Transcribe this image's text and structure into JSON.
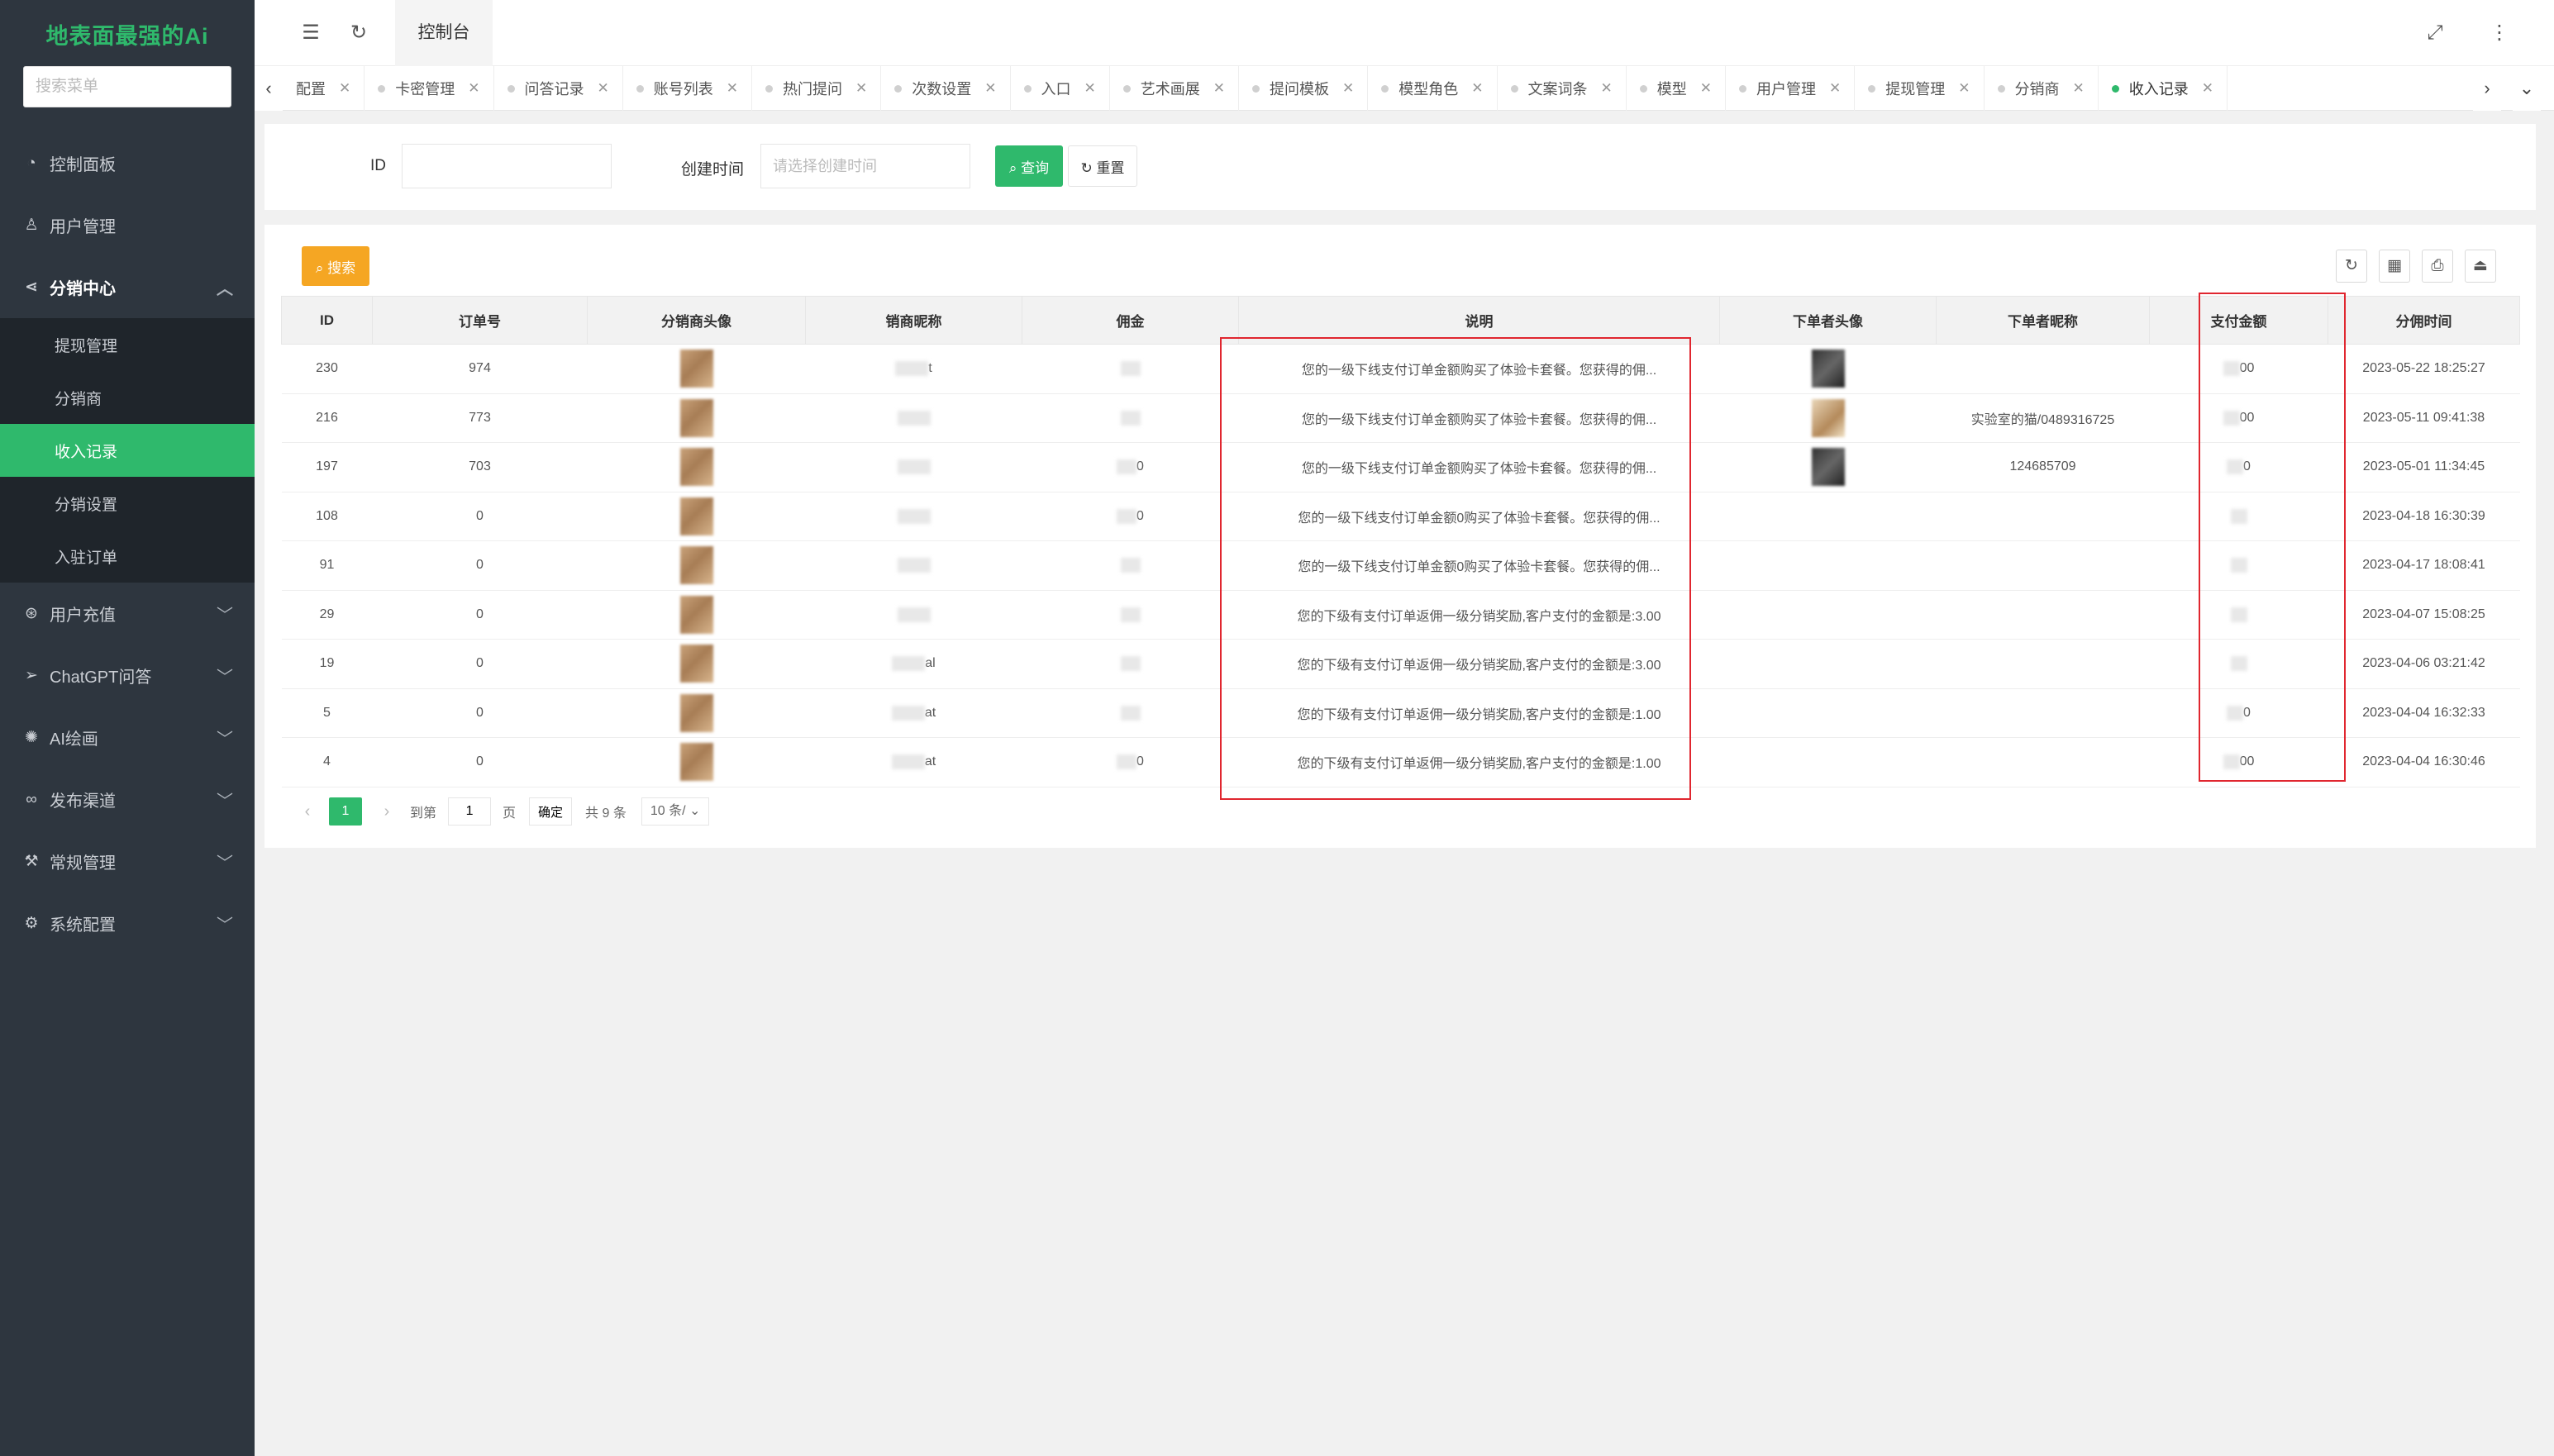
{
  "sidebar": {
    "brand": "地表面最强的Ai",
    "search_placeholder": "搜索菜单",
    "items": [
      {
        "label": "控制面板",
        "icon": "dashboard-icon"
      },
      {
        "label": "用户管理",
        "icon": "user-icon"
      },
      {
        "label": "分销中心",
        "icon": "share-icon",
        "open": true,
        "children": [
          {
            "label": "提现管理"
          },
          {
            "label": "分销商"
          },
          {
            "label": "收入记录",
            "active": true
          },
          {
            "label": "分销设置"
          },
          {
            "label": "入驻订单"
          }
        ]
      },
      {
        "label": "用户充值",
        "icon": "recharge-icon"
      },
      {
        "label": "ChatGPT问答",
        "icon": "send-icon"
      },
      {
        "label": "AI绘画",
        "icon": "palette-icon"
      },
      {
        "label": "发布渠道",
        "icon": "link-icon"
      },
      {
        "label": "常规管理",
        "icon": "tools-icon"
      },
      {
        "label": "系统配置",
        "icon": "gear-icon"
      }
    ]
  },
  "topbar": {
    "console_label": "控制台"
  },
  "tabs": [
    {
      "label": "配置"
    },
    {
      "label": "卡密管理"
    },
    {
      "label": "问答记录"
    },
    {
      "label": "账号列表"
    },
    {
      "label": "热门提问"
    },
    {
      "label": "次数设置"
    },
    {
      "label": "入口"
    },
    {
      "label": "艺术画展"
    },
    {
      "label": "提问模板"
    },
    {
      "label": "模型角色"
    },
    {
      "label": "文案词条"
    },
    {
      "label": "模型"
    },
    {
      "label": "用户管理"
    },
    {
      "label": "提现管理"
    },
    {
      "label": "分销商"
    },
    {
      "label": "收入记录",
      "active": true
    }
  ],
  "search": {
    "id_label": "ID",
    "id_value": "",
    "time_label": "创建时间",
    "time_placeholder": "请选择创建时间",
    "query_label": "查询",
    "reset_label": "重置"
  },
  "toolbar": {
    "search_label": "搜索"
  },
  "table": {
    "columns": [
      "ID",
      "订单号",
      "分销商头像",
      "销商昵称",
      "佣金",
      "说明",
      "下单者头像",
      "下单者昵称",
      "支付金额",
      "分佣时间"
    ],
    "rows": [
      {
        "id": "230",
        "order": "974",
        "nick": "t",
        "commission": "",
        "desc": "您的一级下线支付订单金额购买了体验卡套餐。您获得的佣...",
        "buyer_avatar": "dark",
        "buyer_nick": "",
        "pay": "00",
        "time": "2023-05-22 18:25:27"
      },
      {
        "id": "216",
        "order": "773",
        "nick": "",
        "commission": "",
        "desc": "您的一级下线支付订单金额购买了体验卡套餐。您获得的佣...",
        "buyer_avatar": "mixed",
        "buyer_nick": "实验室的猫/0489316725",
        "pay": "00",
        "time": "2023-05-11 09:41:38"
      },
      {
        "id": "197",
        "order": "703",
        "nick": "",
        "commission": "0",
        "desc": "您的一级下线支付订单金额购买了体验卡套餐。您获得的佣...",
        "buyer_avatar": "dark",
        "buyer_nick": "124685709",
        "pay": "0",
        "time": "2023-05-01 11:34:45"
      },
      {
        "id": "108",
        "order": "0",
        "nick": "",
        "commission": "0",
        "desc": "您的一级下线支付订单金额0购买了体验卡套餐。您获得的佣...",
        "buyer_avatar": "",
        "buyer_nick": "",
        "pay": "",
        "time": "2023-04-18 16:30:39"
      },
      {
        "id": "91",
        "order": "0",
        "nick": "",
        "commission": "",
        "desc": "您的一级下线支付订单金额0购买了体验卡套餐。您获得的佣...",
        "buyer_avatar": "",
        "buyer_nick": "",
        "pay": "",
        "time": "2023-04-17 18:08:41"
      },
      {
        "id": "29",
        "order": "0",
        "nick": "",
        "commission": "",
        "desc": "您的下级有支付订单返佣一级分销奖励,客户支付的金额是:3.00",
        "buyer_avatar": "",
        "buyer_nick": "",
        "pay": "",
        "time": "2023-04-07 15:08:25"
      },
      {
        "id": "19",
        "order": "0",
        "nick": "al",
        "commission": "",
        "desc": "您的下级有支付订单返佣一级分销奖励,客户支付的金额是:3.00",
        "buyer_avatar": "",
        "buyer_nick": "",
        "pay": "",
        "time": "2023-04-06 03:21:42"
      },
      {
        "id": "5",
        "order": "0",
        "nick": "at",
        "commission": "",
        "desc": "您的下级有支付订单返佣一级分销奖励,客户支付的金额是:1.00",
        "buyer_avatar": "",
        "buyer_nick": "",
        "pay": "0",
        "time": "2023-04-04 16:32:33"
      },
      {
        "id": "4",
        "order": "0",
        "nick": "at",
        "commission": "0",
        "desc": "您的下级有支付订单返佣一级分销奖励,客户支付的金额是:1.00",
        "buyer_avatar": "",
        "buyer_nick": "",
        "pay": "00",
        "time": "2023-04-04 16:30:46"
      }
    ]
  },
  "pagination": {
    "current_page": "1",
    "goto_label": "到第",
    "goto_value": "1",
    "page_unit": "页",
    "confirm_label": "确定",
    "total_label": "共 9 条",
    "page_size_label": "10 条/"
  },
  "colors": {
    "sidebar_bg": "#2e363f",
    "accent": "#2fb96c",
    "orange": "#f5a623",
    "annotation_red": "#e0262f"
  }
}
